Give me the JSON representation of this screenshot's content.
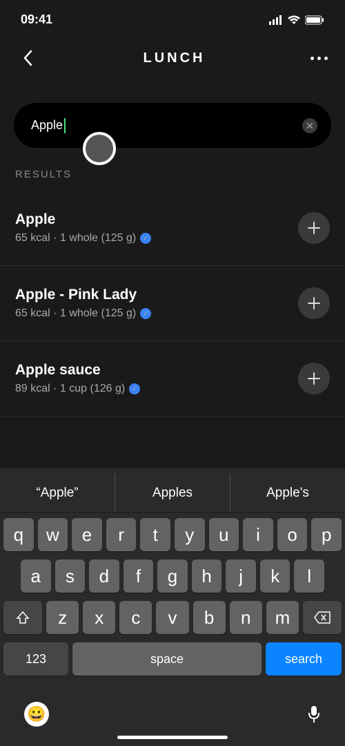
{
  "statusBar": {
    "time": "09:41"
  },
  "header": {
    "title": "LUNCH"
  },
  "search": {
    "value": "Apple"
  },
  "resultsLabel": "RESULTS",
  "results": [
    {
      "name": "Apple",
      "details": "65 kcal · 1 whole (125 g)",
      "verified": true
    },
    {
      "name": "Apple - Pink Lady",
      "details": "65 kcal · 1 whole (125 g)",
      "verified": true
    },
    {
      "name": "Apple sauce",
      "details": "89 kcal · 1 cup (126 g)",
      "verified": true
    }
  ],
  "keyboard": {
    "suggestions": [
      "“Apple”",
      "Apples",
      "Apple's"
    ],
    "row1": [
      "q",
      "w",
      "e",
      "r",
      "t",
      "y",
      "u",
      "i",
      "o",
      "p"
    ],
    "row2": [
      "a",
      "s",
      "d",
      "f",
      "g",
      "h",
      "j",
      "k",
      "l"
    ],
    "row3": [
      "z",
      "x",
      "c",
      "v",
      "b",
      "n",
      "m"
    ],
    "numKey": "123",
    "spaceKey": "space",
    "searchKey": "search"
  }
}
